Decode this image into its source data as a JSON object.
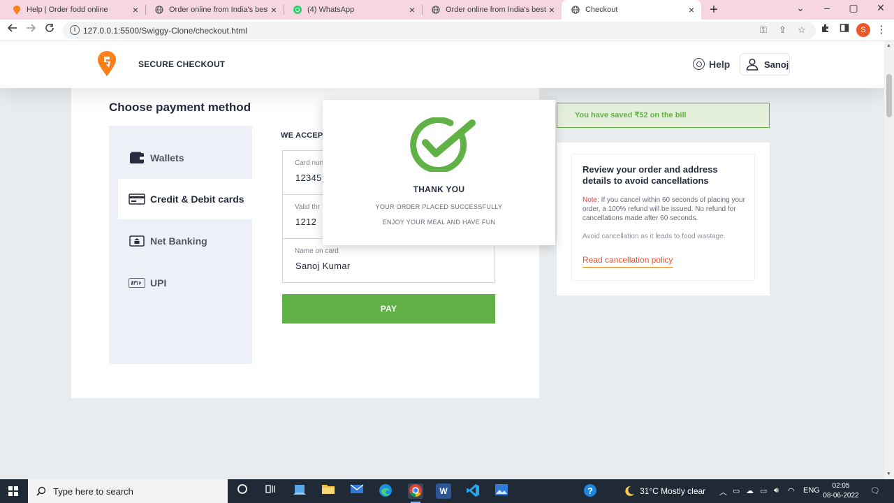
{
  "browser": {
    "tabs": [
      {
        "title": "Help | Order fodd online",
        "favicon": "swiggy-icon",
        "active": false
      },
      {
        "title": "Order online from India's best de",
        "favicon": "globe-icon",
        "active": false
      },
      {
        "title": "(4) WhatsApp",
        "favicon": "whatsapp-icon",
        "active": false
      },
      {
        "title": "Order online from India's best de",
        "favicon": "globe-icon",
        "active": false
      },
      {
        "title": "Checkout",
        "favicon": "globe-icon",
        "active": true
      }
    ],
    "url": "127.0.0.1:5500/Swiggy-Clone/checkout.html",
    "profile_initial": "S"
  },
  "header": {
    "title": "SECURE CHECKOUT",
    "help_label": "Help",
    "user_label": "Sanoj",
    "brand_color": "#fc8019"
  },
  "payment": {
    "heading": "Choose payment method",
    "methods": [
      {
        "label": "Wallets",
        "icon": "wallet-icon",
        "active": false
      },
      {
        "label": "Credit & Debit cards",
        "icon": "credit-card-icon",
        "active": true
      },
      {
        "label": "Net Banking",
        "icon": "bank-icon",
        "active": false
      },
      {
        "label": "UPI",
        "icon": "upi-icon",
        "active": false
      }
    ],
    "we_accept": "WE ACCEP",
    "fields": {
      "card_number": {
        "label": "Card nun",
        "value": "12345"
      },
      "valid_through": {
        "label": "Valid thr",
        "value": "1212"
      },
      "name_on_card": {
        "label": "Name on card",
        "value": "Sanoj Kumar"
      }
    },
    "pay_label": "PAY",
    "pay_color": "#60b246"
  },
  "sidebar": {
    "saved_text": "You have saved ₹52 on the bill",
    "review_title": "Review your order and address details to avoid cancellations",
    "note_label": "Note",
    "note_text": ": If you cancel within 60 seconds of placing your order, a 100% refund will be issued. No refund for cancellations made after 60 seconds.",
    "avoid_text": "Avoid cancellation as it leads to food wastage.",
    "policy_link": "Read cancellation policy"
  },
  "modal": {
    "title": "THANK YOU",
    "line1": "YOUR ORDER PLACED SUCCESSFULLY",
    "line2": "ENJOY YOUR MEAL AND HAVE FUN",
    "check_color": "#60b246"
  },
  "taskbar": {
    "search_placeholder": "Type here to search",
    "weather": "31°C  Mostly clear",
    "language": "ENG",
    "time": "02:05",
    "date": "08-06-2022"
  }
}
